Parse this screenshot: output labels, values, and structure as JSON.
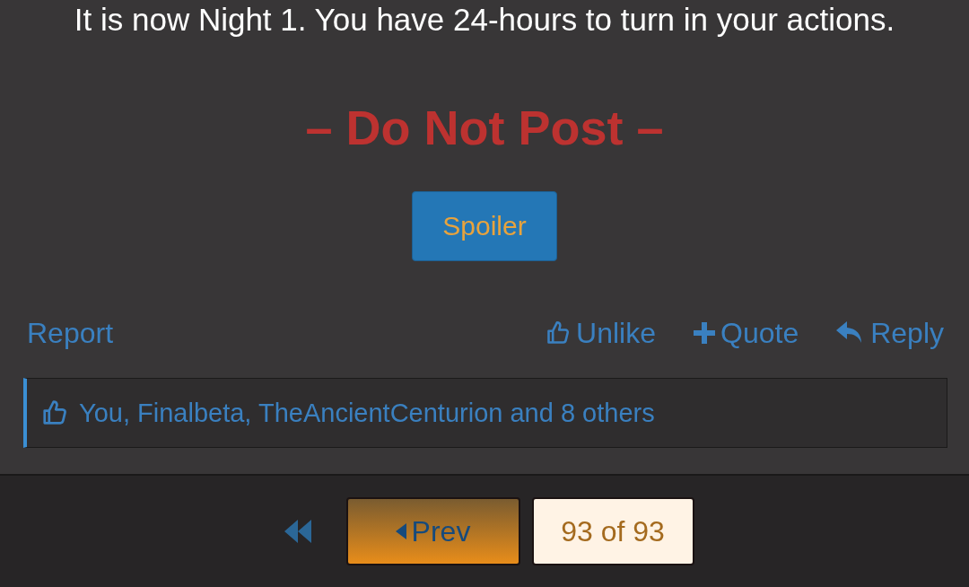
{
  "post": {
    "text": "It is now Night 1. You have 24-hours to turn in your actions.",
    "heading": "– Do Not Post –",
    "spoiler_button": "Spoiler"
  },
  "actions": {
    "report": "Report",
    "buttons": [
      {
        "kind": "unlike",
        "label": "Unlike"
      },
      {
        "kind": "quote",
        "label": "Quote"
      },
      {
        "kind": "reply",
        "label": "Reply"
      }
    ]
  },
  "likes": {
    "text": "You, Finalbeta, TheAncientCenturion and 8 others"
  },
  "pagination": {
    "prev": "Prev",
    "page": "93 of 93"
  }
}
